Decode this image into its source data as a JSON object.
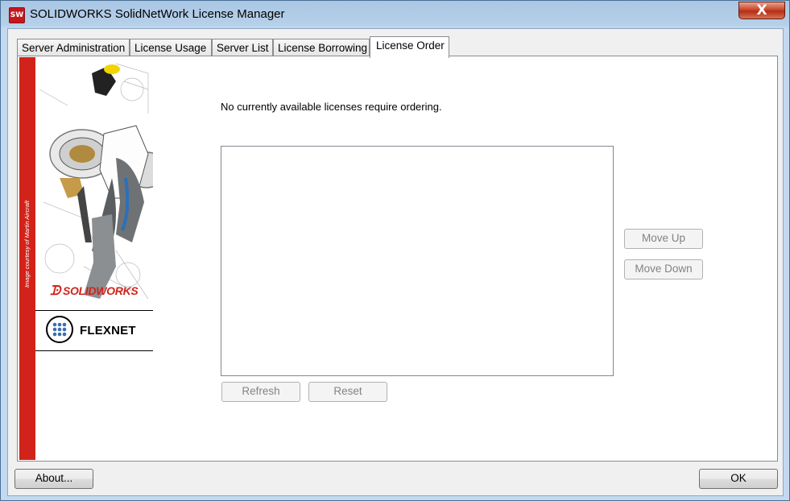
{
  "window": {
    "app_icon_text": "SW",
    "title": "SOLIDWORKS SolidNetWork License Manager",
    "close_glyph": "X",
    "icons": {
      "close": "close-icon",
      "app": "solidworks-app-icon"
    }
  },
  "tabs": [
    {
      "label": "Server Administration",
      "active": false
    },
    {
      "label": "License Usage",
      "active": false
    },
    {
      "label": "Server List",
      "active": false
    },
    {
      "label": "License Borrowing",
      "active": false
    },
    {
      "label": "License Order",
      "active": true
    }
  ],
  "sidebar": {
    "image_credit": "Image courtesy of Martin Aircraft",
    "solidworks_logo": "SOLIDWORKS",
    "flexnet_logo": "FLEXNET",
    "colors": {
      "red_bar": "#d2231a"
    }
  },
  "license_order": {
    "message": "No currently available licenses require ordering.",
    "list_items": [],
    "move_up_label": "Move Up",
    "move_down_label": "Move Down",
    "refresh_label": "Refresh",
    "reset_label": "Reset"
  },
  "footer": {
    "about_label": "About...",
    "ok_label": "OK"
  }
}
